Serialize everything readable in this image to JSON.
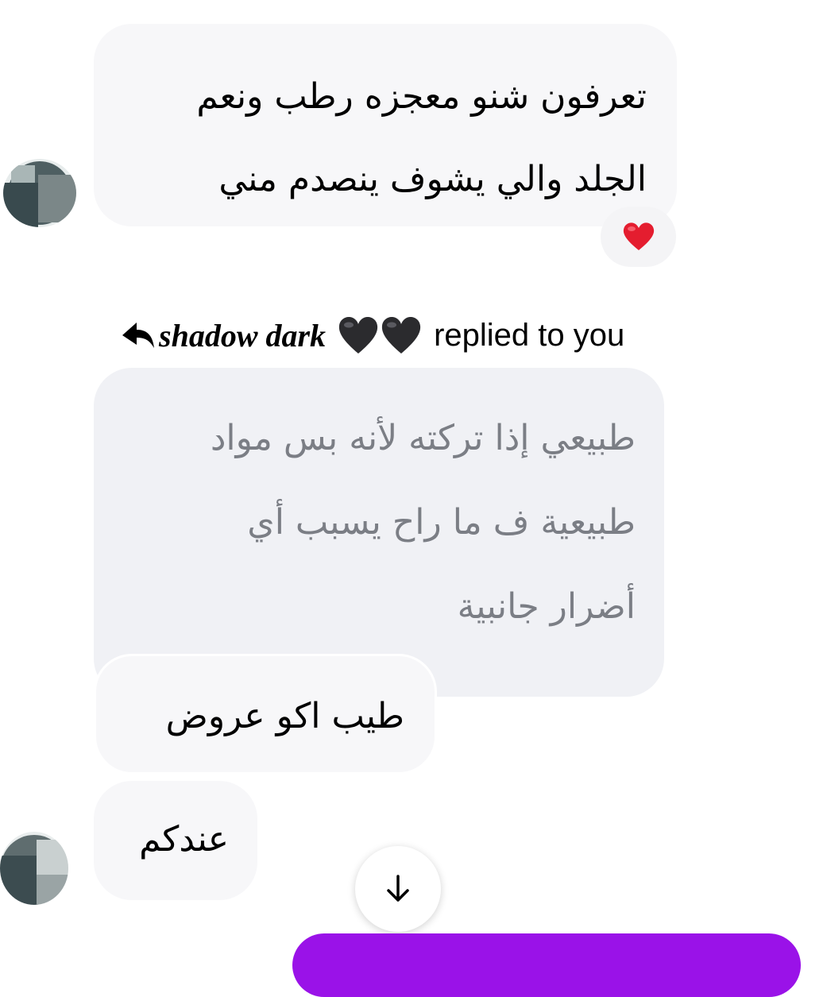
{
  "messages": [
    {
      "lines": [
        "تعرفون شنو معجزه رطب ونعم",
        "الجلد والي يشوف ينصدم مني"
      ],
      "reaction": "❤️"
    },
    {
      "reply_header": {
        "name": "shadow dark",
        "text": "replied to you"
      },
      "quoted_lines": [
        "طبيعي إذا تركته لأنه بس مواد",
        "طبيعية ف ما راح يسبب أي",
        "أضرار جانبية"
      ]
    },
    {
      "text": "طيب اكو عروض"
    },
    {
      "text": "عندكم"
    }
  ],
  "colors": {
    "bubble_incoming": "#f7f7f9",
    "bubble_quoted": "#f0f1f5",
    "quoted_text": "#7b7e85",
    "composer_accent": "#9a12e8",
    "reaction_heart": "#e41d2f"
  },
  "icons": {
    "reply": "reply-arrow-icon",
    "hearts": "black-heart-icon",
    "scroll": "arrow-down-icon"
  }
}
